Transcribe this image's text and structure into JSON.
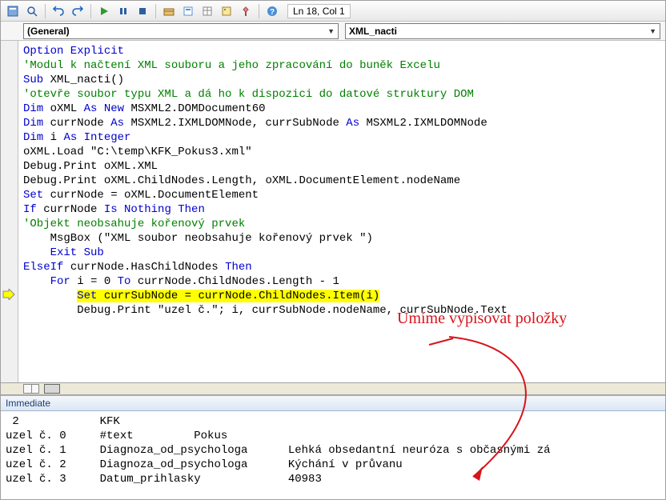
{
  "toolbar": {
    "status": "Ln 18, Col 1"
  },
  "dropdowns": {
    "left": "(General)",
    "right": "XML_nacti"
  },
  "code": {
    "l01a": "Option Explicit",
    "l02a": "'Modul k načtení XML souboru a jeho zpracování do buněk Excelu",
    "l03a": "Sub",
    "l03b": " XML_nacti()",
    "l04a": "'otevře soubor typu XML a dá ho k dispozici do datové struktury DOM",
    "l05a": "Dim",
    "l05b": " oXML ",
    "l05c": "As New",
    "l05d": " MSXML2.DOMDocument60",
    "l06a": "Dim",
    "l06b": " currNode ",
    "l06c": "As",
    "l06d": " MSXML2.IXMLDOMNode, currSubNode ",
    "l06e": "As",
    "l06f": " MSXML2.IXMLDOMNode",
    "l07a": "Dim",
    "l07b": " i ",
    "l07c": "As Integer",
    "l08a": "oXML.Load \"C:\\temp\\KFK_Pokus3.xml\"",
    "l09a": "Debug.Print oXML.XML",
    "l10a": "Debug.Print oXML.ChildNodes.Length, oXML.DocumentElement.nodeName",
    "l11a": "Set",
    "l11b": " currNode = oXML.DocumentElement",
    "l12a": "If",
    "l12b": " currNode ",
    "l12c": "Is Nothing Then",
    "l13a": "'Objekt neobsahuje kořenový prvek",
    "l14a": "    MsgBox (\"XML soubor neobsahuje kořenový prvek \")",
    "l15a": "    Exit Sub",
    "l16a": "ElseIf",
    "l16b": " currNode.HasChildNodes ",
    "l16c": "Then",
    "l17a": "    For",
    "l17b": " i = 0 ",
    "l17c": "To",
    "l17d": " currNode.ChildNodes.Length - 1",
    "l18a": "        ",
    "l18b": "Set",
    "l18c": " currSubNode = currNode.ChildNodes.Item(i)",
    "l19a": "        Debug.Print \"uzel č.\"; i, currSubNode.nodeName, currSubNode.Text"
  },
  "immediate_title": "Immediate",
  "immediate": {
    "l1": " 2            KFK",
    "l2": "uzel č. 0     #text         Pokus",
    "l3": "uzel č. 1     Diagnoza_od_psychologa      Lehká obsedantní neuróza s občasnými zá",
    "l4": "uzel č. 2     Diagnoza_od_psychologa      Kýchání v průvanu",
    "l5": "uzel č. 3     Datum_prihlasky             40983"
  },
  "annotation": "Umíme vypisovat položky"
}
